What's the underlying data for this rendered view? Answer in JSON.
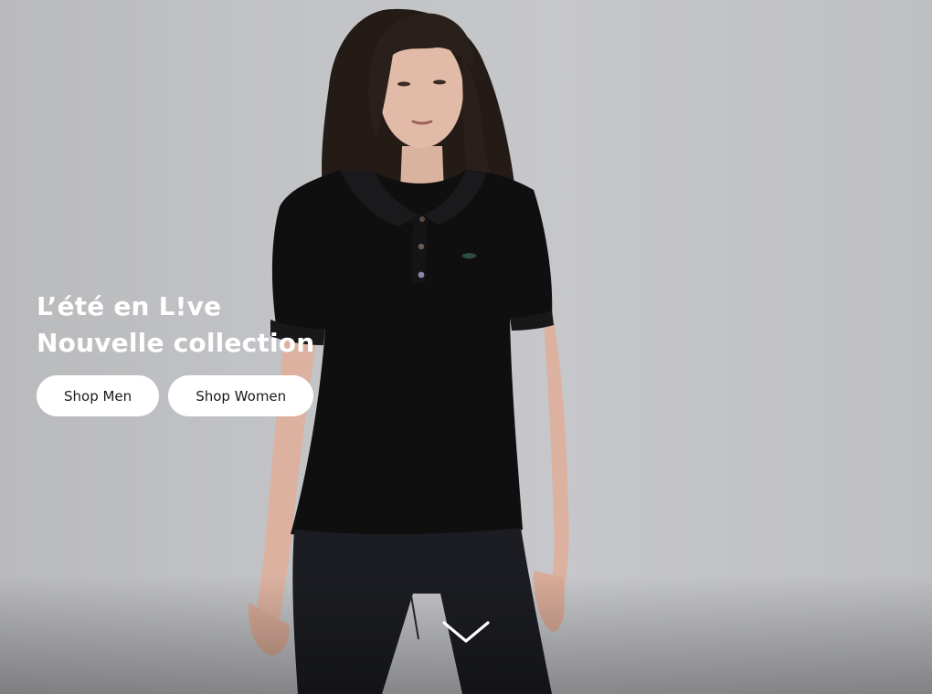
{
  "hero": {
    "headline_line1": "L’été en L!ve",
    "headline_line2": "Nouvelle collection",
    "shop_men_label": "Shop Men",
    "shop_women_label": "Shop Women"
  },
  "icons": {
    "scroll": "chevron-down-icon",
    "brand": "crocodile-logo-icon"
  },
  "colors": {
    "background": "#c3c4c7",
    "shirt": "#0f0f10",
    "jeans": "#1c1d22",
    "button_bg": "#ffffff",
    "text_light": "#ffffff",
    "text_dark": "#1a1a1a"
  }
}
